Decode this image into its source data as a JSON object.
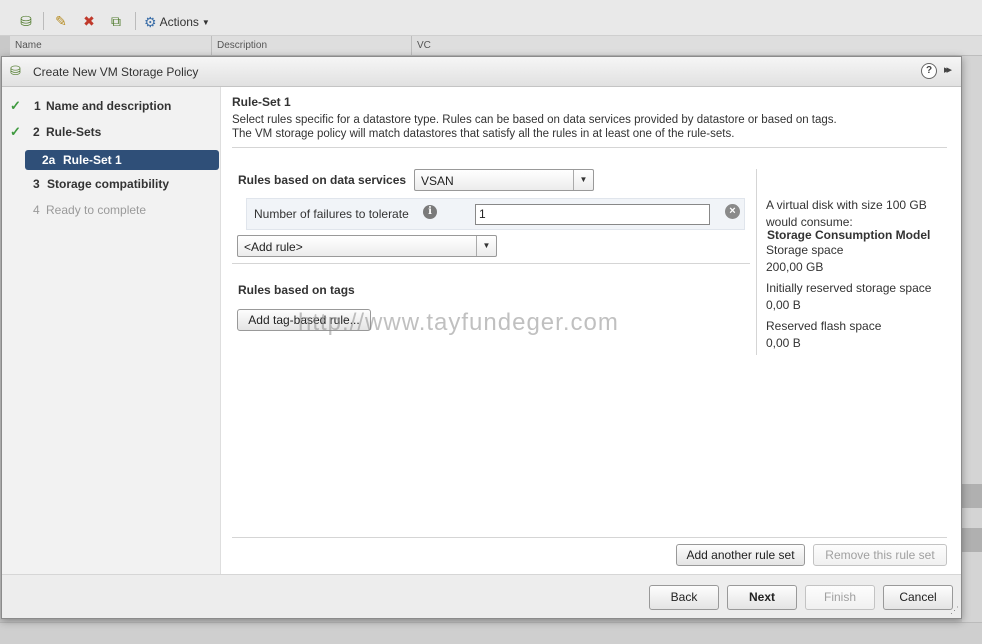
{
  "background": {
    "toolbar": {
      "actions_label": "Actions",
      "icons": [
        "new-vm-storage-policy-icon",
        "edit-pencil-icon",
        "delete-policy-icon",
        "clone-policy-icon",
        "gear-icon"
      ]
    },
    "grid_columns": [
      "Name",
      "Description",
      "VC"
    ]
  },
  "dialog": {
    "title": "Create New VM Storage Policy",
    "help_label": "?",
    "expand_label": "▸▸"
  },
  "nav": {
    "steps": [
      {
        "num": "1",
        "label": "Name and description",
        "state": "done"
      },
      {
        "num": "2",
        "label": "Rule-Sets",
        "state": "done"
      },
      {
        "num": "3",
        "label": "Storage compatibility",
        "state": "pending"
      },
      {
        "num": "4",
        "label": "Ready to complete",
        "state": "disabled"
      }
    ],
    "substep": {
      "num": "2a",
      "label": "Rule-Set 1"
    }
  },
  "content": {
    "title": "Rule-Set 1",
    "desc_line1": "Select rules specific for a datastore type. Rules can be based on data services provided by datastore or based on tags.",
    "desc_line2": "The VM storage policy will match datastores that satisfy all the rules in at least one of the rule-sets.",
    "data_services_label": "Rules based on data services",
    "data_services_value": "VSAN",
    "rule": {
      "label": "Number of failures to tolerate",
      "value": "1"
    },
    "add_rule_value": "<Add rule>",
    "tags_label": "Rules based on tags",
    "add_tag_button": "Add tag-based rule...",
    "watermark": "http://www.tayfundeger.com",
    "consumption": {
      "title": "Storage Consumption Model",
      "intro_line1": "A virtual disk with size 100 GB",
      "intro_line2": "would consume:",
      "storage_space_label": "Storage space",
      "storage_space_value": "200,00 GB",
      "reserved_label": "Initially reserved storage space",
      "reserved_value": "0,00 B",
      "flash_label": "Reserved flash space",
      "flash_value": "0,00 B"
    },
    "add_ruleset_button": "Add another rule set",
    "remove_ruleset_button": "Remove this rule set"
  },
  "footer": {
    "back": "Back",
    "next": "Next",
    "finish": "Finish",
    "cancel": "Cancel"
  }
}
